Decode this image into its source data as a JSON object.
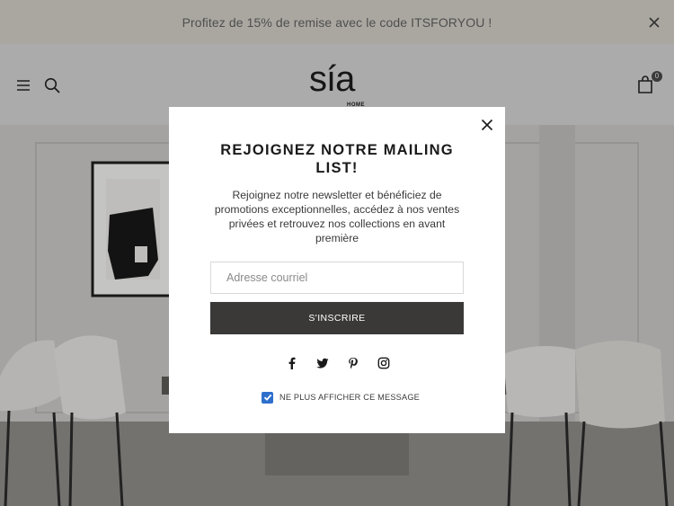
{
  "announcement": {
    "text": "Profitez de 15% de remise avec le code ITSFORYOU !",
    "close_icon": "close-icon"
  },
  "header": {
    "menu_icon": "hamburger-menu-icon",
    "search_icon": "search-icon",
    "logo": {
      "main": "sía",
      "sub": "HOME"
    },
    "cart": {
      "icon": "shopping-bag-icon",
      "count": "0"
    }
  },
  "modal": {
    "title": "REJOIGNEZ NOTRE MAILING LIST!",
    "description": "Rejoignez notre newsletter et bénéficiez de promotions exceptionnelles, accédez à nos ventes privées et retrouvez nos collections en avant première",
    "email": {
      "placeholder": "Adresse courriel",
      "value": ""
    },
    "submit_label": "S'INSCRIRE",
    "socials": [
      "facebook-icon",
      "twitter-icon",
      "pinterest-icon",
      "instagram-icon"
    ],
    "checkbox": {
      "checked": true,
      "label": "NE PLUS AFFICHER CE MESSAGE"
    }
  },
  "colors": {
    "announcement_bg": "#aaa7a1",
    "header_bg": "#ababab",
    "button_bg": "#3a3937",
    "checkbox": "#2e6fcc"
  }
}
